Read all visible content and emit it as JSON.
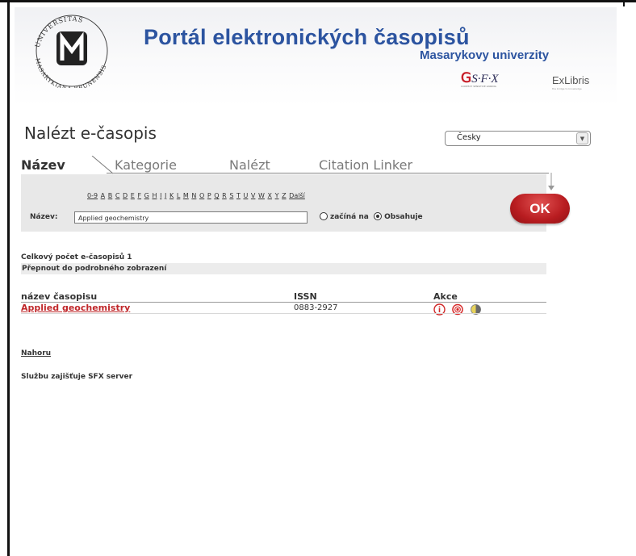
{
  "header": {
    "title": "Portál elektronických časopisů",
    "subtitle": "Masarykovy univerzity",
    "seal": {
      "top_text": "UNIVERSITAS",
      "bottom_text": "MASARYKIANA BRUNENSIS",
      "monogram": "M"
    },
    "sfx": {
      "brand": "S·F·X",
      "tag": "CONTEXT SENSITIVE LINKING"
    },
    "exlibris": {
      "brand": "ExLibris",
      "tag": "the bridge to knowledge"
    }
  },
  "find": {
    "title": "Nalézt e-časopis"
  },
  "language": {
    "selected": "Česky",
    "arrow": "▼"
  },
  "tabs": [
    {
      "label": "Název",
      "active": true
    },
    {
      "label": "Kategorie",
      "active": false
    },
    {
      "label": "Nalézt",
      "active": false
    },
    {
      "label": "Citation Linker",
      "active": false
    }
  ],
  "alphabet": [
    "0-9",
    "A",
    "B",
    "C",
    "D",
    "E",
    "F",
    "G",
    "H",
    "I",
    "J",
    "K",
    "L",
    "M",
    "N",
    "O",
    "P",
    "Q",
    "R",
    "S",
    "T",
    "U",
    "V",
    "W",
    "X",
    "Y",
    "Z",
    "Další"
  ],
  "search": {
    "label": "Název:",
    "value": "Applied geochemistry",
    "options": [
      {
        "label": "začíná na",
        "checked": false
      },
      {
        "label": "Obsahuje",
        "checked": true
      }
    ],
    "ok": "OK"
  },
  "results": {
    "total": "Celkový počet e-časopisů 1",
    "toggle_view": "Přepnout do podrobného zobrazení",
    "columns": [
      "název časopisu",
      "ISSN",
      "Akce"
    ],
    "rows": [
      {
        "title": "Applied geochemistry",
        "issn": "0883-2927"
      }
    ],
    "action_icons": [
      "info-icon",
      "sfx-icon",
      "half-circle-icon"
    ]
  },
  "footer": {
    "top_link": "Nahoru",
    "service_text": "Službu zajišťuje SFX server"
  },
  "colors": {
    "brand_blue": "#2c54a0",
    "link_red": "#c0282b",
    "ok_red": "#b81c20",
    "panel_gray": "#e8e8e8"
  }
}
